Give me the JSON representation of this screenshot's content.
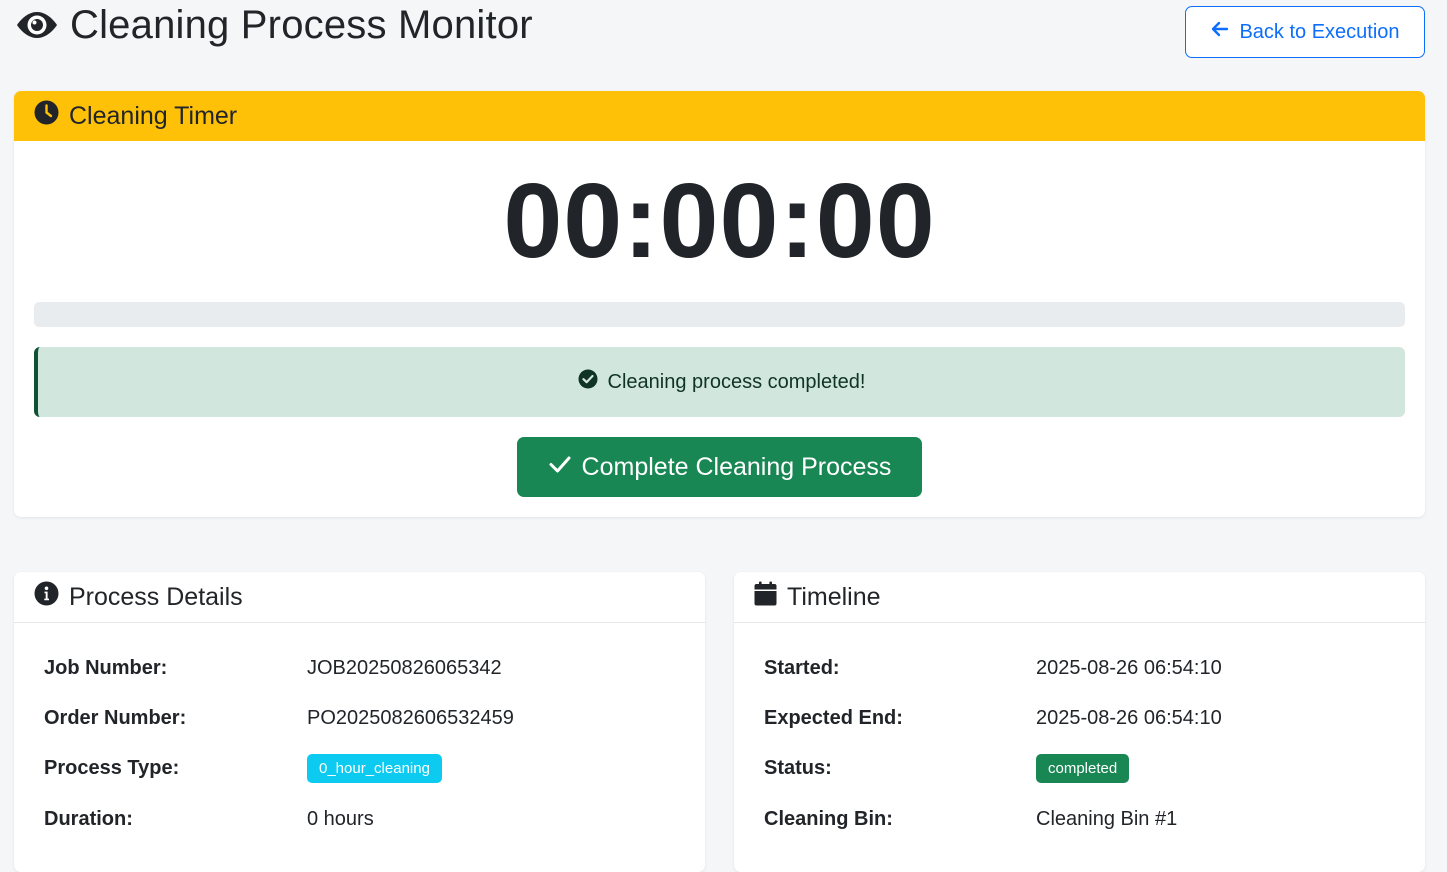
{
  "header": {
    "title": "Cleaning Process Monitor",
    "title_icon": "eye-icon",
    "back_button": "Back to Execution"
  },
  "timer": {
    "header_title": "Cleaning Timer",
    "header_icon": "clock-icon",
    "time": "00:00:00",
    "progress_percent": 0,
    "alert_text": "Cleaning process completed!",
    "complete_button": "Complete Cleaning Process"
  },
  "process_details": {
    "title": "Process Details",
    "icon": "info-circle-icon",
    "rows": [
      {
        "label": "Job Number:",
        "value": "JOB20250826065342"
      },
      {
        "label": "Order Number:",
        "value": "PO2025082606532459"
      },
      {
        "label": "Process Type:",
        "value": "0_hour_cleaning"
      },
      {
        "label": "Duration:",
        "value": "0 hours"
      }
    ]
  },
  "timeline": {
    "title": "Timeline",
    "icon": "calendar-icon",
    "rows": [
      {
        "label": "Started:",
        "value": "2025-08-26 06:54:10"
      },
      {
        "label": "Expected End:",
        "value": "2025-08-26 06:54:10"
      },
      {
        "label": "Status:",
        "value": "completed"
      },
      {
        "label": "Cleaning Bin:",
        "value": "Cleaning Bin #1"
      }
    ]
  },
  "colors": {
    "primary": "#0d6efd",
    "warning": "#ffc107",
    "success": "#198754",
    "info": "#0dcaf0",
    "alert_bg": "#d1e7dd"
  }
}
